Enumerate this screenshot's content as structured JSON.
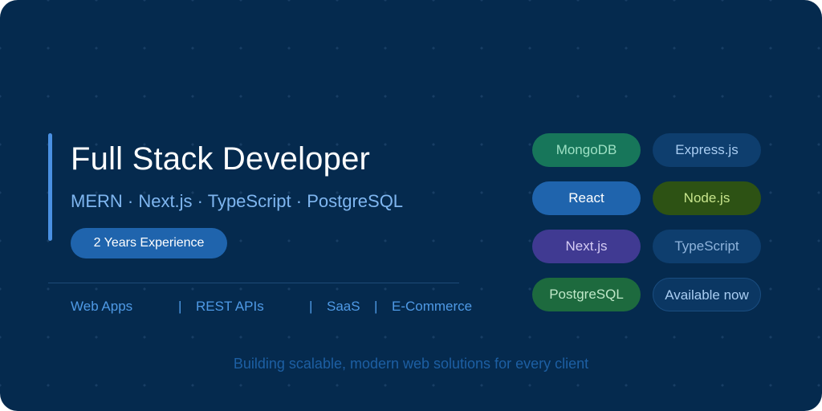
{
  "hero": {
    "title": "Full Stack Developer",
    "stack": "MERN · Next.js · TypeScript · PostgreSQL",
    "experience_badge": "2 Years Experience"
  },
  "services": {
    "items": [
      "Web Apps",
      "|",
      "REST APIs",
      "|",
      "SaaS",
      "|",
      "E-Commerce"
    ]
  },
  "tech_pills": [
    {
      "label": "MongoDB",
      "bg": "#17765a",
      "fg": "#9de0c4"
    },
    {
      "label": "Express.js",
      "bg": "#0e3e6e",
      "fg": "#a9cdf2"
    },
    {
      "label": "React",
      "bg": "#1f64ad",
      "fg": "#ffffff"
    },
    {
      "label": "Node.js",
      "bg": "#2d5214",
      "fg": "#c8e58c"
    },
    {
      "label": "Next.js",
      "bg": "#403a92",
      "fg": "#d5ccf5"
    },
    {
      "label": "TypeScript",
      "bg": "#0e3e6e",
      "fg": "#8fb4dc"
    },
    {
      "label": "PostgreSQL",
      "bg": "#1d6a3e",
      "fg": "#bfe8c8"
    },
    {
      "label": "Available now",
      "bg": "#0b3763",
      "fg": "#a9cdf2"
    }
  ],
  "footer": {
    "tagline": "Building scalable, modern web solutions for every client"
  },
  "colors": {
    "background": "#052a4e",
    "accent": "#4a90e2",
    "badge": "#1f64ad"
  }
}
